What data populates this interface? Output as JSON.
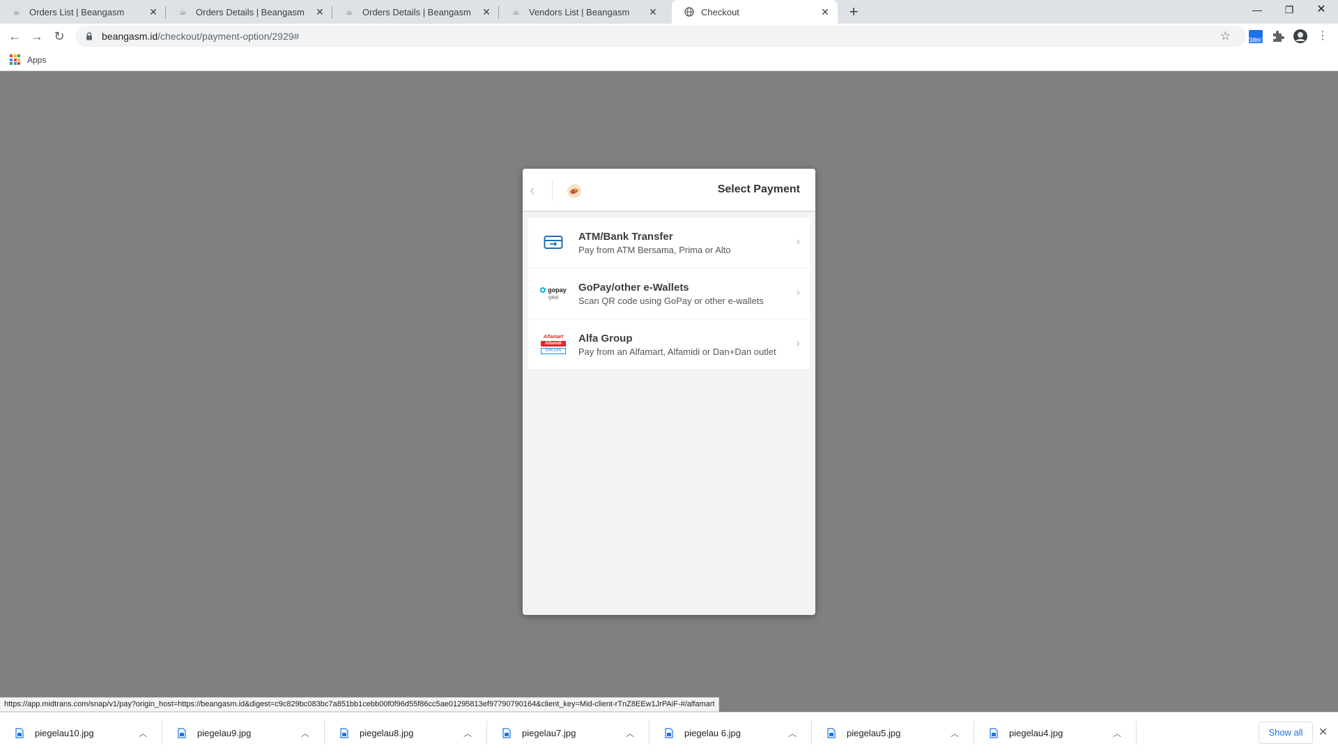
{
  "browser": {
    "tabs": [
      {
        "title": "Orders List | Beangasm",
        "active": false
      },
      {
        "title": "Orders Details | Beangasm",
        "active": false
      },
      {
        "title": "Orders Details | Beangasm",
        "active": false
      },
      {
        "title": "Vendors List | Beangasm",
        "active": false
      },
      {
        "title": "Checkout",
        "active": true
      }
    ],
    "new_tab_label": "+",
    "url_host": "beangasm.id",
    "url_path": "/checkout/payment-option/2929#",
    "ext_badge": "18m",
    "bookmarks": {
      "apps_label": "Apps"
    }
  },
  "checkout": {
    "title": "Select Payment",
    "methods": [
      {
        "name": "ATM/Bank Transfer",
        "description": "Pay from ATM Bersama, Prima or Alto",
        "icon": "bank-transfer-card-icon"
      },
      {
        "name": "GoPay/other e-Wallets",
        "description": "Scan QR code using GoPay or other e-wallets",
        "icon": "gopay-logo",
        "logo_text": "gopay",
        "logo_sub": "QRIS"
      },
      {
        "name": "Alfa Group",
        "description": "Pay from an Alfamart, Alfamidi or Dan+Dan outlet",
        "icon": "alfa-group-logo",
        "logo_line1": "Alfamart",
        "logo_line2": "Alfamidi",
        "logo_line3": "DAN DAN"
      }
    ]
  },
  "status_url": "https://app.midtrans.com/snap/v1/pay?origin_host=https://beangasm.id&digest=c9c829bc083bc7a851bb1cebb00f0f96d55f86cc5ae01295813ef97790790164&client_key=Mid-client-rTnZ8EEw1JrPAiF-#/alfamart",
  "downloads": {
    "files": [
      "piegelau10.jpg",
      "piegelau9.jpg",
      "piegelau8.jpg",
      "piegelau7.jpg",
      "piegelau 6.jpg",
      "piegelau5.jpg",
      "piegelau4.jpg"
    ],
    "show_all_label": "Show all"
  },
  "colors": {
    "overlay": "#808080",
    "link": "#1a73e8",
    "bank_icon": "#1f6fb5",
    "gopay_blue": "#00aed6",
    "alfa_red": "#e3242b"
  }
}
